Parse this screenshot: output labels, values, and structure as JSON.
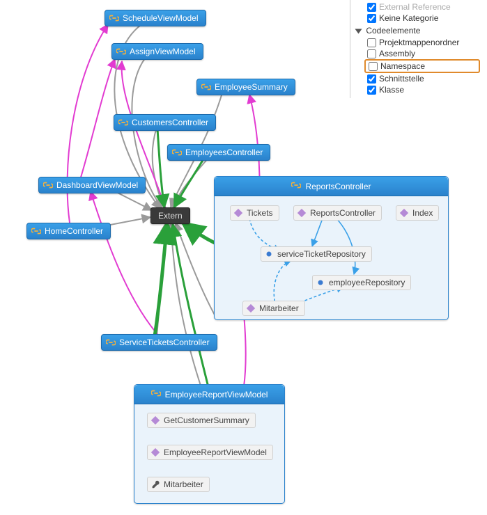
{
  "nodes": {
    "scheduleViewModel": "ScheduleViewModel",
    "assignViewModel": "AssignViewModel",
    "employeeSummary": "EmployeeSummary",
    "customersController": "CustomersController",
    "employeesController": "EmployeesController",
    "dashboardViewModel": "DashboardViewModel",
    "homeController": "HomeController",
    "serviceTicketsController": "ServiceTicketsController",
    "extern": "Extern"
  },
  "groups": {
    "reportsController": {
      "title": "ReportsController",
      "members": {
        "tickets": "Tickets",
        "reportsCtor": "ReportsController",
        "index": "Index",
        "serviceTicketRepository": "serviceTicketRepository",
        "employeeRepository": "employeeRepository",
        "mitarbeiter": "Mitarbeiter"
      }
    },
    "employeeReportViewModel": {
      "title": "EmployeeReportViewModel",
      "members": {
        "getCustomerSummary": "GetCustomerSummary",
        "ctor": "EmployeeReportViewModel",
        "mitarbeiter": "Mitarbeiter"
      }
    }
  },
  "legend": {
    "externalReference": "External Reference",
    "keineKategorie": "Keine Kategorie",
    "codeelemente": "Codeelemente",
    "projektmappenordner": "Projektmappenordner",
    "assembly": "Assembly",
    "namespace": "Namespace",
    "schnittstelle": "Schnittstelle",
    "klasse": "Klasse"
  },
  "legendState": {
    "externalReference": true,
    "keineKategorie": true,
    "projektmappenordner": false,
    "assembly": false,
    "namespace": false,
    "schnittstelle": true,
    "klasse": true
  }
}
